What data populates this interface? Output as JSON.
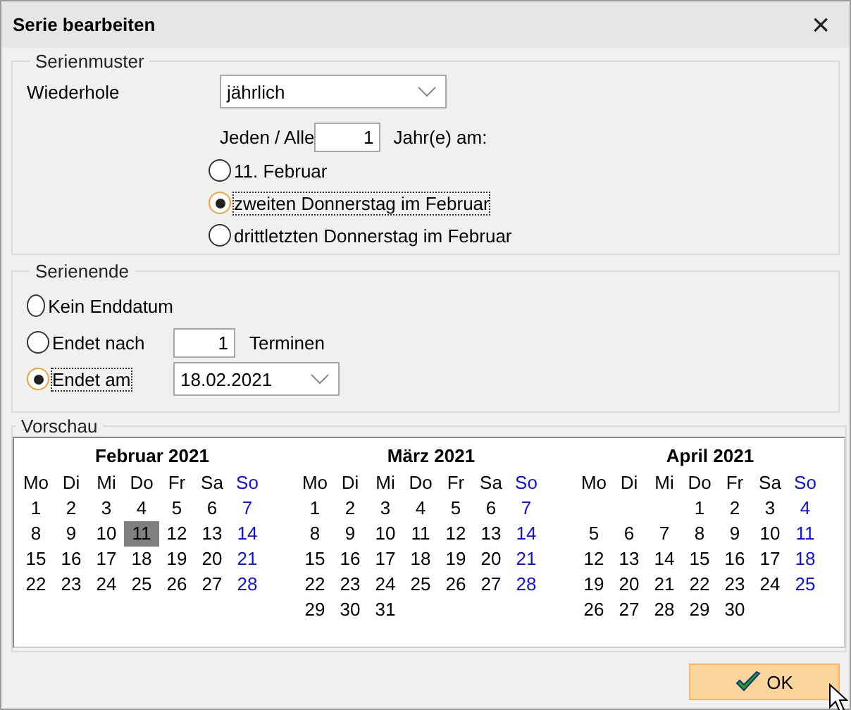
{
  "window": {
    "title": "Serie bearbeiten",
    "close": "×"
  },
  "pattern": {
    "legend": "Serienmuster",
    "repeat_label": "Wiederhole",
    "repeat_value": "jährlich",
    "every_label": "Jeden / Alle",
    "every_value": "1",
    "every_suffix": "Jahr(e) am:",
    "options": [
      {
        "label": "11. Februar",
        "selected": false
      },
      {
        "label": "zweiten Donnerstag im Februar",
        "selected": true
      },
      {
        "label": "drittletzten Donnerstag im Februar",
        "selected": false
      }
    ]
  },
  "end": {
    "legend": "Serienende",
    "options": [
      {
        "label": "Kein Enddatum",
        "selected": false,
        "kind": "plain"
      },
      {
        "label": "Endet nach",
        "selected": false,
        "kind": "count",
        "value": "1",
        "suffix": "Terminen"
      },
      {
        "label": "Endet am",
        "selected": true,
        "kind": "date",
        "value": "18.02.2021"
      }
    ]
  },
  "preview": {
    "legend": "Vorschau",
    "months": [
      {
        "title": "Februar 2021",
        "weekdays": [
          "Mo",
          "Di",
          "Mi",
          "Do",
          "Fr",
          "Sa",
          "So"
        ],
        "weeks": [
          [
            {
              "d": "1",
              "selected": false
            },
            {
              "d": "2",
              "selected": false
            },
            {
              "d": "3",
              "selected": false
            },
            {
              "d": "4",
              "selected": false
            },
            {
              "d": "5",
              "selected": false
            },
            {
              "d": "6",
              "selected": false
            },
            {
              "d": "7",
              "selected": false
            }
          ],
          [
            {
              "d": "8",
              "selected": false
            },
            {
              "d": "9",
              "selected": false
            },
            {
              "d": "10",
              "selected": false
            },
            {
              "d": "11",
              "selected": true
            },
            {
              "d": "12",
              "selected": false
            },
            {
              "d": "13",
              "selected": false
            },
            {
              "d": "14",
              "selected": false
            }
          ],
          [
            {
              "d": "15",
              "selected": false
            },
            {
              "d": "16",
              "selected": false
            },
            {
              "d": "17",
              "selected": false
            },
            {
              "d": "18",
              "selected": false
            },
            {
              "d": "19",
              "selected": false
            },
            {
              "d": "20",
              "selected": false
            },
            {
              "d": "21",
              "selected": false
            }
          ],
          [
            {
              "d": "22",
              "selected": false
            },
            {
              "d": "23",
              "selected": false
            },
            {
              "d": "24",
              "selected": false
            },
            {
              "d": "25",
              "selected": false
            },
            {
              "d": "26",
              "selected": false
            },
            {
              "d": "27",
              "selected": false
            },
            {
              "d": "28",
              "selected": false
            }
          ]
        ]
      },
      {
        "title": "März 2021",
        "weekdays": [
          "Mo",
          "Di",
          "Mi",
          "Do",
          "Fr",
          "Sa",
          "So"
        ],
        "weeks": [
          [
            {
              "d": "1",
              "selected": false
            },
            {
              "d": "2",
              "selected": false
            },
            {
              "d": "3",
              "selected": false
            },
            {
              "d": "4",
              "selected": false
            },
            {
              "d": "5",
              "selected": false
            },
            {
              "d": "6",
              "selected": false
            },
            {
              "d": "7",
              "selected": false
            }
          ],
          [
            {
              "d": "8",
              "selected": false
            },
            {
              "d": "9",
              "selected": false
            },
            {
              "d": "10",
              "selected": false
            },
            {
              "d": "11",
              "selected": false
            },
            {
              "d": "12",
              "selected": false
            },
            {
              "d": "13",
              "selected": false
            },
            {
              "d": "14",
              "selected": false
            }
          ],
          [
            {
              "d": "15",
              "selected": false
            },
            {
              "d": "16",
              "selected": false
            },
            {
              "d": "17",
              "selected": false
            },
            {
              "d": "18",
              "selected": false
            },
            {
              "d": "19",
              "selected": false
            },
            {
              "d": "20",
              "selected": false
            },
            {
              "d": "21",
              "selected": false
            }
          ],
          [
            {
              "d": "22",
              "selected": false
            },
            {
              "d": "23",
              "selected": false
            },
            {
              "d": "24",
              "selected": false
            },
            {
              "d": "25",
              "selected": false
            },
            {
              "d": "26",
              "selected": false
            },
            {
              "d": "27",
              "selected": false
            },
            {
              "d": "28",
              "selected": false
            }
          ],
          [
            {
              "d": "29",
              "selected": false
            },
            {
              "d": "30",
              "selected": false
            },
            {
              "d": "31",
              "selected": false
            }
          ]
        ]
      },
      {
        "title": "April 2021",
        "weekdays": [
          "Mo",
          "Di",
          "Mi",
          "Do",
          "Fr",
          "Sa",
          "So"
        ],
        "weeks": [
          [
            {
              "d": "1",
              "selected": false
            },
            {
              "d": "2",
              "selected": false
            },
            {
              "d": "3",
              "selected": false
            },
            {
              "d": "4",
              "selected": false
            }
          ],
          [
            {
              "d": "5",
              "selected": false
            },
            {
              "d": "6",
              "selected": false
            },
            {
              "d": "7",
              "selected": false
            },
            {
              "d": "8",
              "selected": false
            },
            {
              "d": "9",
              "selected": false
            },
            {
              "d": "10",
              "selected": false
            },
            {
              "d": "11",
              "selected": false
            }
          ],
          [
            {
              "d": "12",
              "selected": false
            },
            {
              "d": "13",
              "selected": false
            },
            {
              "d": "14",
              "selected": false
            },
            {
              "d": "15",
              "selected": false
            },
            {
              "d": "16",
              "selected": false
            },
            {
              "d": "17",
              "selected": false
            },
            {
              "d": "18",
              "selected": false
            }
          ],
          [
            {
              "d": "19",
              "selected": false
            },
            {
              "d": "20",
              "selected": false
            },
            {
              "d": "21",
              "selected": false
            },
            {
              "d": "22",
              "selected": false
            },
            {
              "d": "23",
              "selected": false
            },
            {
              "d": "24",
              "selected": false
            },
            {
              "d": "25",
              "selected": false
            }
          ],
          [
            {
              "d": "26",
              "selected": false
            },
            {
              "d": "27",
              "selected": false
            },
            {
              "d": "28",
              "selected": false
            },
            {
              "d": "29",
              "selected": false
            },
            {
              "d": "30",
              "selected": false
            }
          ]
        ]
      }
    ]
  },
  "buttons": [
    {
      "label": "OK",
      "kind": "ok",
      "hovered": true
    }
  ]
}
